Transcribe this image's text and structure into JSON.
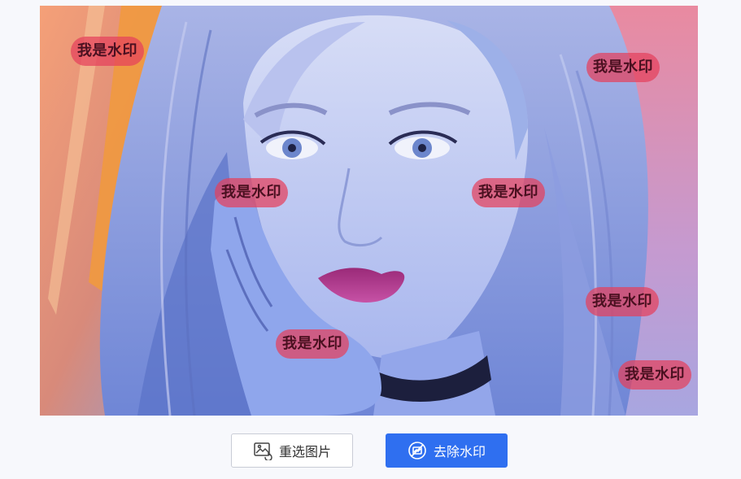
{
  "image": {
    "description_icon": "portrait-image",
    "watermark_text": "我是水印",
    "watermark_color": "#e4405c"
  },
  "watermarks": [
    {
      "text": "我是水印"
    },
    {
      "text": "我是水印"
    },
    {
      "text": "我是水印"
    },
    {
      "text": "我是水印"
    },
    {
      "text": "我是水印"
    },
    {
      "text": "我是水印"
    },
    {
      "text": "我是水印"
    }
  ],
  "actions": {
    "reselect_label": "重选图片",
    "reselect_icon": "image-refresh-icon",
    "remove_label": "去除水印",
    "remove_icon": "no-watermark-icon",
    "primary_color": "#2f6ff0"
  }
}
